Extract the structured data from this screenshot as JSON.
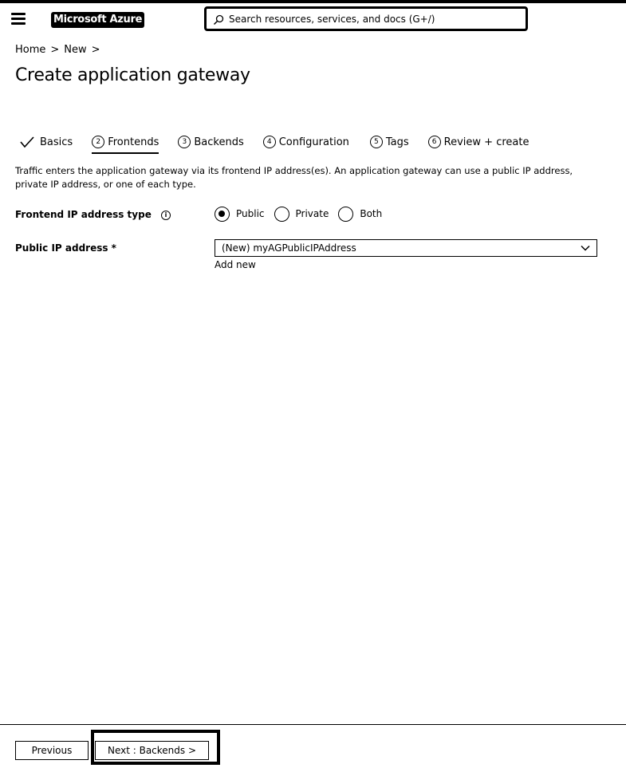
{
  "header": {
    "brand": "Microsoft Azure",
    "search_placeholder": "Search resources, services, and docs (G+/)"
  },
  "breadcrumb": {
    "items": [
      "Home",
      "New"
    ],
    "separator": ">"
  },
  "page": {
    "title": "Create application gateway"
  },
  "tabs": [
    {
      "label": "Basics",
      "number": "",
      "state": "completed"
    },
    {
      "label": "Frontends",
      "number": "2",
      "state": "active"
    },
    {
      "label": "Backends",
      "number": "3",
      "state": "upcoming"
    },
    {
      "label": "Configuration",
      "number": "4",
      "state": "upcoming"
    },
    {
      "label": "Tags",
      "number": "5",
      "state": "upcoming"
    },
    {
      "label": "Review + create",
      "number": "6",
      "state": "upcoming"
    }
  ],
  "description": "Traffic enters the application gateway via its frontend IP address(es). An application gateway can use a public IP address, private IP address, or one of each type.",
  "form": {
    "ip_type_label": "Frontend IP address type",
    "ip_type_options": [
      {
        "label": "Public",
        "selected": true
      },
      {
        "label": "Private",
        "selected": false
      },
      {
        "label": "Both",
        "selected": false
      }
    ],
    "public_ip_label": "Public IP address *",
    "public_ip_value": "(New) myAGPublicIPAddress",
    "add_new_label": "Add new"
  },
  "footer": {
    "previous_label": "Previous",
    "next_label": "Next : Backends >"
  },
  "icons": {
    "menu": "hamburger-menu-icon",
    "search": "search-icon",
    "check": "checkmark-icon",
    "info": "info-icon",
    "dropdown": "chevron-down-icon"
  }
}
